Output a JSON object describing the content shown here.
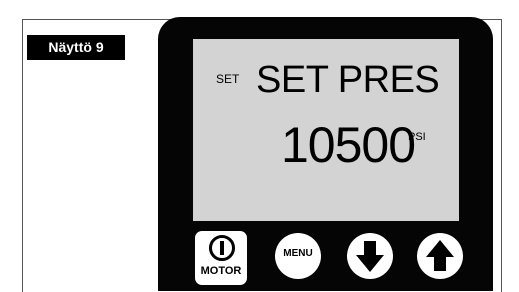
{
  "screen_label": "Näyttö 9",
  "display": {
    "mode_indicator": "SET",
    "title": "SET PRES",
    "value": "10500",
    "unit": "PSI"
  },
  "buttons": {
    "motor_label": "MOTOR",
    "menu_label": "MENU",
    "down_icon": "arrow-down-icon",
    "up_icon": "arrow-up-icon",
    "power_icon": "power-icon"
  },
  "colors": {
    "device_body": "#050505",
    "lcd_background": "#d3d3d3",
    "button_face": "#ffffff"
  }
}
